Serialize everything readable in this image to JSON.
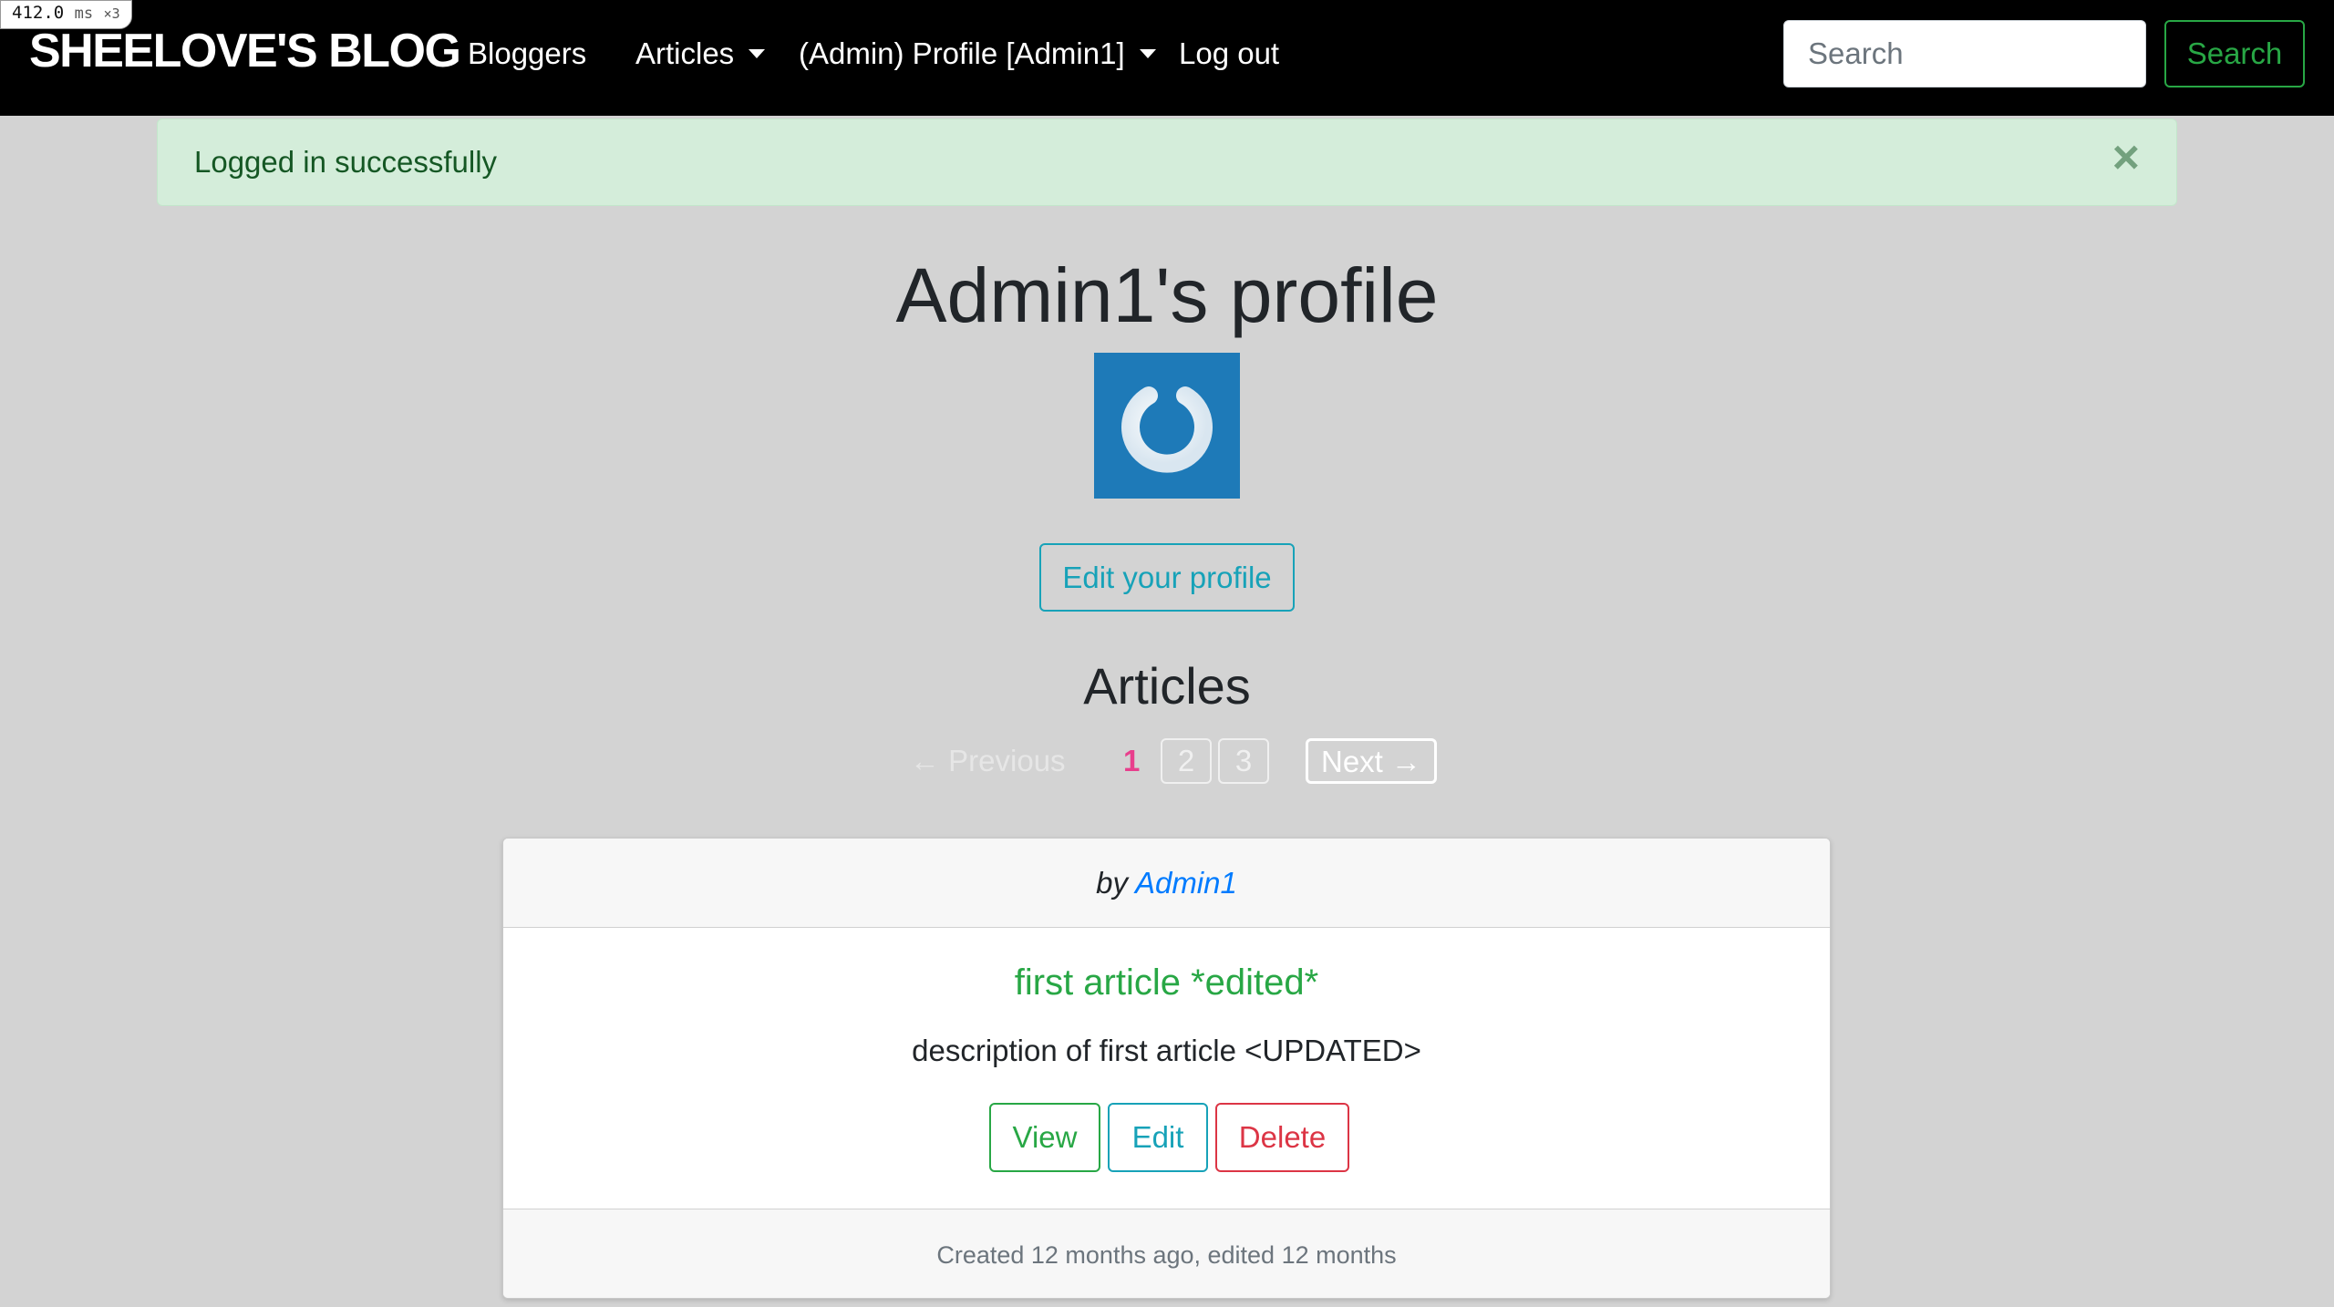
{
  "perf": {
    "value": "412.0",
    "unit": "ms",
    "multiplier": "×3"
  },
  "navbar": {
    "brand": "SHEELOVE'S BLOG",
    "links": {
      "bloggers": "Bloggers",
      "articles": "Articles",
      "profile": "(Admin) Profile [Admin1]",
      "logout": "Log out"
    },
    "search_placeholder": "Search",
    "search_button": "Search"
  },
  "alert": {
    "message": "Logged in successfully",
    "close": "×"
  },
  "profile": {
    "title": "Admin1's profile",
    "edit_button": "Edit your profile",
    "articles_heading": "Articles"
  },
  "pagination": {
    "previous": "← Previous",
    "current": "1",
    "pages": [
      "2",
      "3"
    ],
    "next": "Next →"
  },
  "article": {
    "by_label": "by",
    "author": "Admin1",
    "title": "first article *edited*",
    "description": "description of first article <UPDATED>",
    "view_button": "View",
    "edit_button": "Edit",
    "delete_button": "Delete",
    "footer": "Created 12 months ago, edited 12 months"
  },
  "colors": {
    "navbar_bg": "#000000",
    "page_bg": "#d3d3d3",
    "success": "#28a745",
    "info": "#17a2b8",
    "danger": "#dc3545",
    "link": "#007bff",
    "pagination_current": "#e83e8c",
    "avatar_bg": "#1e7ab8"
  },
  "icons": {
    "avatar": "power-icon",
    "alert_close": "close-icon"
  }
}
